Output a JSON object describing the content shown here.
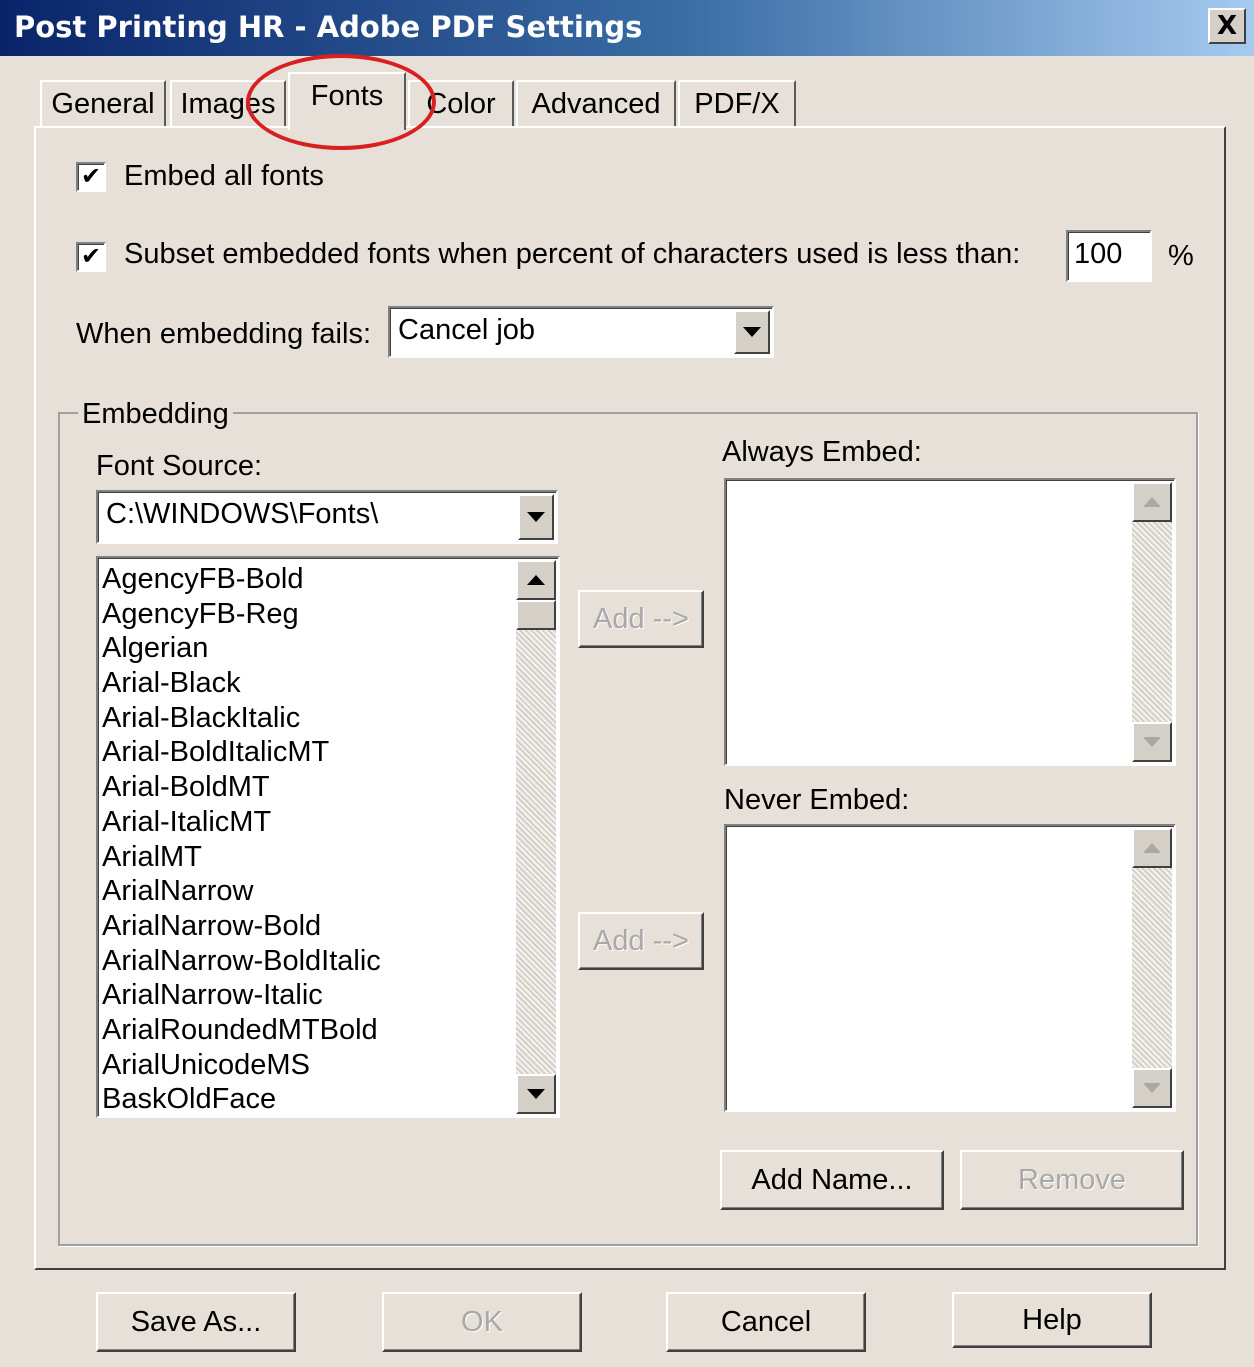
{
  "window": {
    "title": "Post Printing HR - Adobe PDF Settings",
    "close_label": "X"
  },
  "tabs": [
    {
      "label": "General"
    },
    {
      "label": "Images"
    },
    {
      "label": "Fonts"
    },
    {
      "label": "Color"
    },
    {
      "label": "Advanced"
    },
    {
      "label": "PDF/X"
    }
  ],
  "active_tab": "Fonts",
  "annotation": {
    "color": "#d92020"
  },
  "fonts_tab": {
    "embed_all": {
      "label": "Embed all fonts",
      "checked": true,
      "mark": "✔"
    },
    "subset": {
      "label": "Subset embedded fonts when percent of characters used is less than:",
      "checked": true,
      "mark": "✔",
      "value": "100",
      "unit": "%"
    },
    "embed_fail": {
      "label": "When embedding fails:",
      "selected": "Cancel job"
    },
    "embedding": {
      "legend": "Embedding",
      "font_source_label": "Font Source:",
      "font_source_value": "C:\\WINDOWS\\Fonts\\",
      "fonts": [
        "AgencyFB-Bold",
        "AgencyFB-Reg",
        "Algerian",
        "Arial-Black",
        "Arial-BlackItalic",
        "Arial-BoldItalicMT",
        "Arial-BoldMT",
        "Arial-ItalicMT",
        "ArialMT",
        "ArialNarrow",
        "ArialNarrow-Bold",
        "ArialNarrow-BoldItalic",
        "ArialNarrow-Italic",
        "ArialRoundedMTBold",
        "ArialUnicodeMS",
        "BaskOldFace"
      ],
      "add_always_label": "Add -->",
      "add_never_label": "Add -->",
      "always_embed_label": "Always Embed:",
      "never_embed_label": "Never Embed:",
      "add_name_label": "Add Name...",
      "remove_label": "Remove"
    }
  },
  "footer": {
    "save_as_label": "Save As...",
    "ok_label": "OK",
    "cancel_label": "Cancel",
    "help_label": "Help"
  }
}
